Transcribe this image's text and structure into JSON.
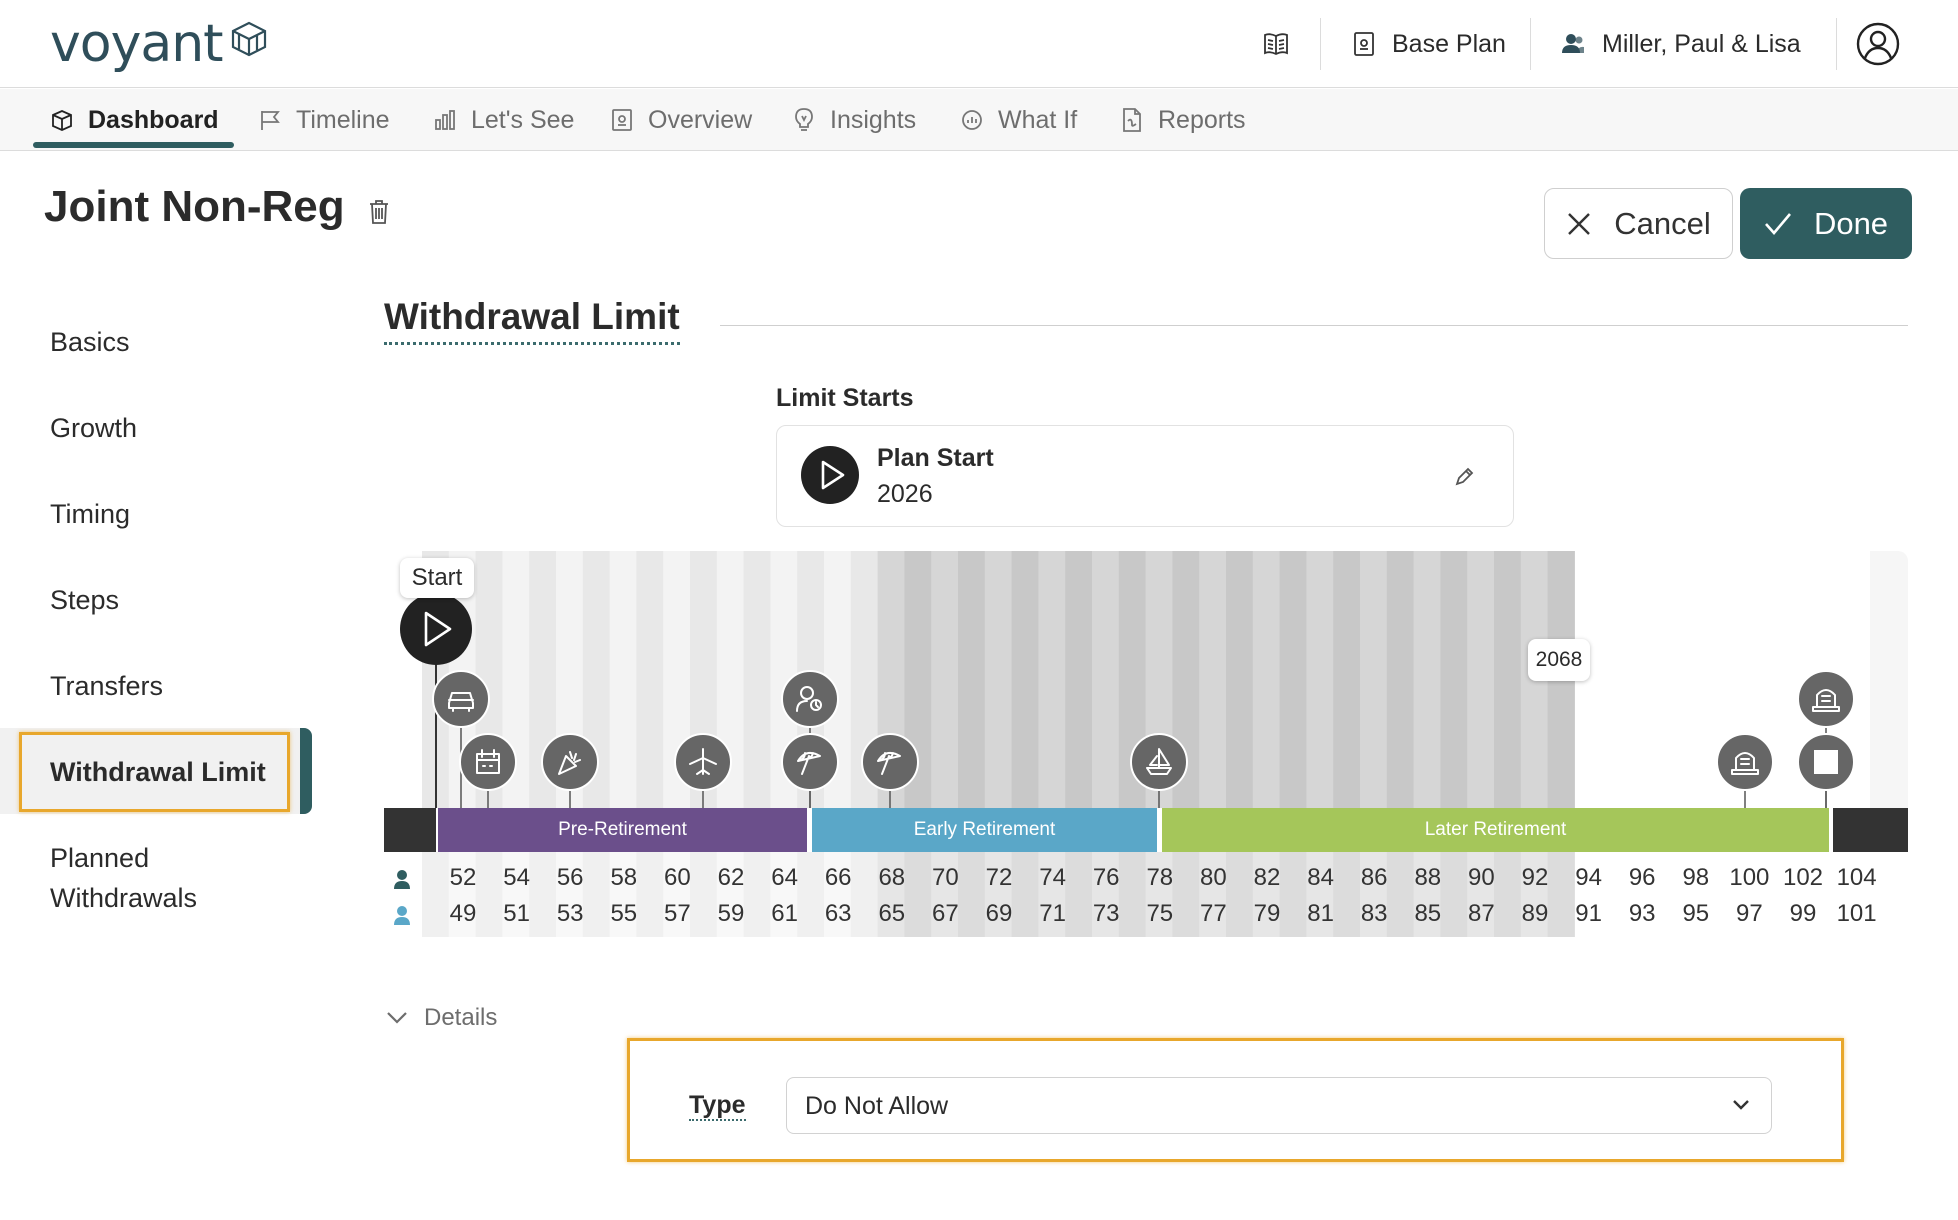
{
  "header": {
    "logo_text": "voyant",
    "plan_label": "Base Plan",
    "client_label": "Miller, Paul & Lisa"
  },
  "nav": {
    "tabs": [
      {
        "label": "Dashboard",
        "icon": "dashboard-icon",
        "active": true
      },
      {
        "label": "Timeline",
        "icon": "flag-icon",
        "active": false
      },
      {
        "label": "Let's See",
        "icon": "bar-chart-icon",
        "active": false
      },
      {
        "label": "Overview",
        "icon": "overview-icon",
        "active": false
      },
      {
        "label": "Insights",
        "icon": "lightbulb-icon",
        "active": false
      },
      {
        "label": "What If",
        "icon": "what-if-icon",
        "active": false
      },
      {
        "label": "Reports",
        "icon": "report-icon",
        "active": false
      }
    ]
  },
  "page": {
    "title": "Joint Non-Reg",
    "cancel_label": "Cancel",
    "done_label": "Done"
  },
  "sidebar": {
    "items": [
      {
        "label": "Basics"
      },
      {
        "label": "Growth"
      },
      {
        "label": "Timing"
      },
      {
        "label": "Steps"
      },
      {
        "label": "Transfers"
      },
      {
        "label": "Withdrawal Limit",
        "active": true
      },
      {
        "label": "Planned Withdrawals"
      }
    ]
  },
  "section": {
    "title": "Withdrawal Limit",
    "limit_starts_label": "Limit Starts",
    "limit_start_name": "Plan Start",
    "limit_start_year": "2026"
  },
  "timeline": {
    "start_tooltip": "Start",
    "hover_year": "2068",
    "phases": [
      {
        "label": "Pre-Retirement",
        "color": "#6b4f8b"
      },
      {
        "label": "Early Retirement",
        "color": "#5aa7c8"
      },
      {
        "label": "Later Retirement",
        "color": "#a5c65a"
      }
    ],
    "person1_ages": [
      "52",
      "54",
      "56",
      "58",
      "60",
      "62",
      "64",
      "66",
      "68",
      "70",
      "72",
      "74",
      "76",
      "78",
      "80",
      "82",
      "84",
      "86",
      "88",
      "90",
      "92",
      "94",
      "96",
      "98",
      "100",
      "102",
      "104"
    ],
    "person2_ages": [
      "49",
      "51",
      "53",
      "55",
      "57",
      "59",
      "61",
      "63",
      "65",
      "67",
      "69",
      "71",
      "73",
      "75",
      "77",
      "79",
      "81",
      "83",
      "85",
      "87",
      "89",
      "91",
      "93",
      "95",
      "97",
      "99",
      "101"
    ],
    "person1_color": "#2f5d60",
    "person2_color": "#5aa7c8"
  },
  "details": {
    "toggle_label": "Details",
    "type_label": "Type",
    "type_value": "Do Not Allow"
  },
  "colors": {
    "accent": "#2f5d60",
    "highlight": "#e8a72c"
  }
}
